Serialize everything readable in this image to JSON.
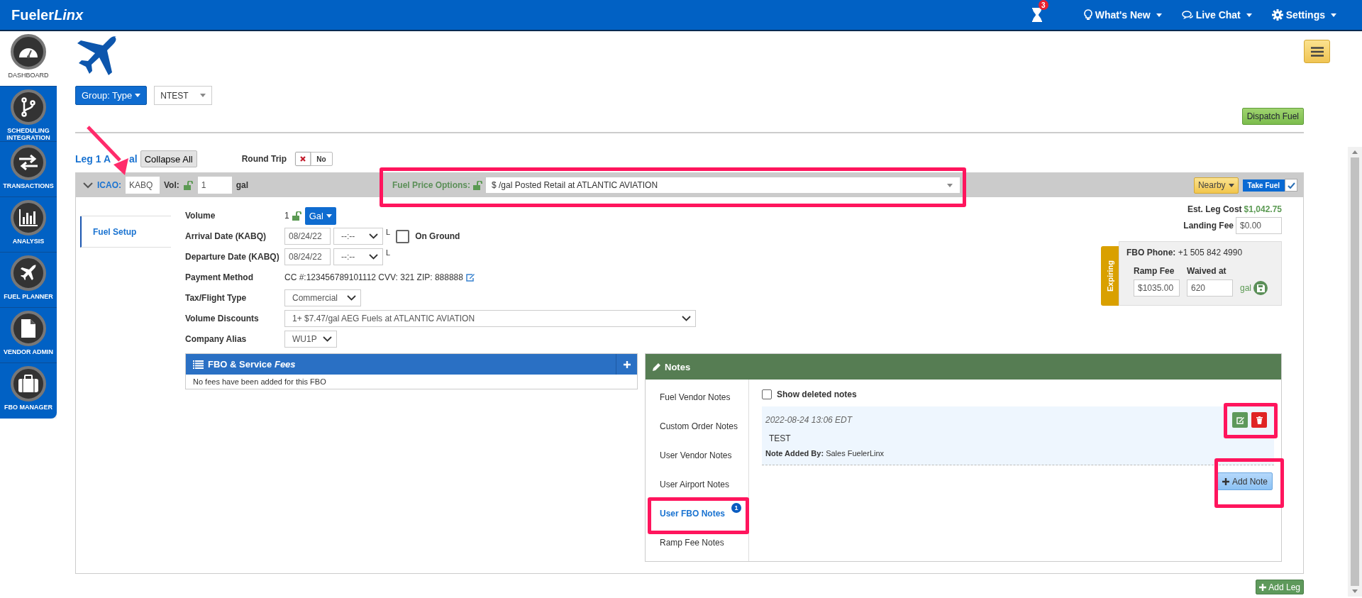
{
  "header": {
    "logo": {
      "main": "Fueler",
      "italic": "Linx"
    },
    "badge": "3",
    "menus": [
      {
        "kind": "bulb",
        "label": "What's New"
      },
      {
        "kind": "chat",
        "label": "Live Chat"
      },
      {
        "kind": "gear",
        "label": "Settings"
      }
    ]
  },
  "sidebar": {
    "items": [
      {
        "kind": "dashboard",
        "label": "DASHBOARD",
        "selected": true
      },
      {
        "kind": "scheduling",
        "label": "SCHEDULING INTEGRATION",
        "selected": false
      },
      {
        "kind": "transactions",
        "label": "TRANSACTIONS",
        "selected": false
      },
      {
        "kind": "analysis",
        "label": "ANALYSIS",
        "selected": false
      },
      {
        "kind": "planner",
        "label": "FUEL PLANNER",
        "selected": false
      },
      {
        "kind": "vendor",
        "label": "VENDOR ADMIN",
        "selected": false
      },
      {
        "kind": "fbo",
        "label": "FBO MANAGER",
        "selected": false
      }
    ]
  },
  "toolbar": {
    "group_button": "Group: Type",
    "tail_select": "NTEST",
    "dispatch_button": "Dispatch Fuel"
  },
  "leg": {
    "title_visible_parts": [
      "Leg 1 A",
      "al"
    ],
    "collapse_button": "Collapse All",
    "round_trip": {
      "label": "Round Trip",
      "on": false,
      "text": "No"
    },
    "icao_label": "ICAO:",
    "icao": "KABQ",
    "vol_label": "Vol:",
    "vol": "1",
    "vol_unit": "gal",
    "fuel_price_label": "Fuel Price Options:",
    "fuel_price": "$ /gal Posted Retail at ATLANTIC AVIATION",
    "nearby_button": "Nearby",
    "take_fuel": {
      "label": "Take Fuel",
      "checked": true
    }
  },
  "tabs": [
    {
      "label": "Fuel Setup",
      "selected": true
    }
  ],
  "form": {
    "volume": {
      "label": "Volume",
      "value": "1",
      "unit": "Gal"
    },
    "arrival": {
      "label": "Arrival Date (KABQ)",
      "date": "08/24/22",
      "time": "--:--",
      "zone": "L"
    },
    "on_ground": {
      "label": "On Ground",
      "checked": false
    },
    "departure": {
      "label": "Departure Date (KABQ)",
      "date": "08/24/22",
      "time": "--:--",
      "zone": "L"
    },
    "payment": {
      "label": "Payment Method",
      "value": "CC #:123456789101112 CVV: 321 ZIP: 888888"
    },
    "tax": {
      "label": "Tax/Flight Type",
      "value": "Commercial"
    },
    "discounts": {
      "label": "Volume Discounts",
      "value": "1+ $7.47/gal AEG Fuels at ATLANTIC AVIATION"
    },
    "alias": {
      "label": "Company Alias",
      "value": "WU1P"
    }
  },
  "costs": {
    "est_label": "Est. Leg Cost",
    "est_value": "$1,042.75",
    "landing_label": "Landing Fee",
    "landing_value": "$0.00"
  },
  "fbo_card": {
    "status": "Expiring",
    "phone": "**FBO Phone:** +1 505 842 4990",
    "ramp_label": "Ramp Fee",
    "ramp_value": "$1035.00",
    "waived_label": "Waived at",
    "waived_value": "620",
    "unit": "gal"
  },
  "fees_panel": {
    "title": "FBO & Service *Fees*",
    "empty": "No fees have been added for this FBO"
  },
  "notes_panel": {
    "title": "Notes",
    "categories": [
      {
        "label": "Fuel Vendor Notes",
        "selected": false
      },
      {
        "label": "Custom Order Notes",
        "selected": false
      },
      {
        "label": "User Vendor Notes",
        "selected": false
      },
      {
        "label": "User Airport Notes",
        "selected": false
      },
      {
        "label": "User FBO Notes",
        "selected": true,
        "badge": "1"
      },
      {
        "label": "Ramp Fee Notes",
        "selected": false
      }
    ],
    "show_deleted": {
      "label": "Show deleted notes",
      "checked": false
    },
    "note": {
      "time": "2022-08-24 13:06 EDT",
      "text": "TEST",
      "added_by": "**Note Added By:** Sales FuelerLinx"
    },
    "add_note": "Add Note"
  },
  "add_leg": "Add Leg"
}
